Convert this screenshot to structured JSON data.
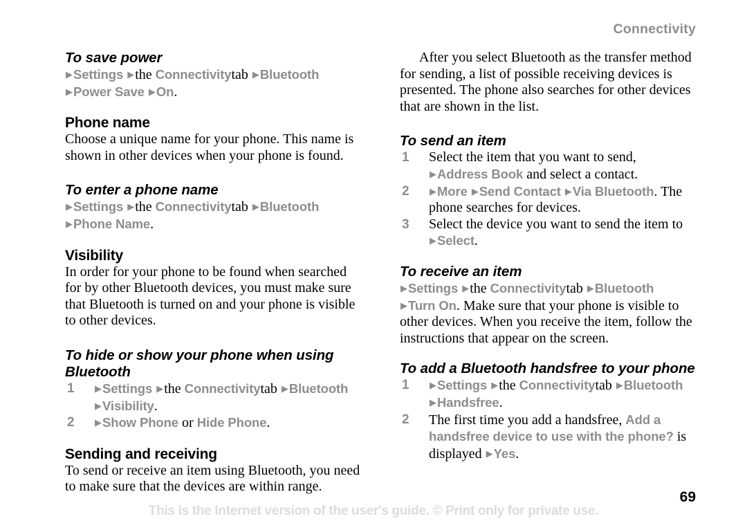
{
  "header": {
    "running_title": "Connectivity"
  },
  "footer": {
    "notice": "This is the Internet version of the user's guide. © Print only for private use.",
    "page_number": "69"
  },
  "glyphs": {
    "arrow": "▶"
  },
  "colors": {
    "ui_term_gray": "#8d8d8d",
    "body_black": "#000000",
    "footer_gray": "#dcdcdc",
    "page_background": "#ffffff"
  },
  "left_column": {
    "save_power": {
      "heading": "To save power",
      "line1": {
        "t1": "Settings",
        "mid": "the",
        "t2": "Connectivity",
        "tab": "tab",
        "t3": "Bluetooth"
      },
      "line2": {
        "t1": "Power Save",
        "t2": "On",
        "period": "."
      }
    },
    "phone_name": {
      "heading": "Phone name",
      "paragraph": "Choose a unique name for your phone. This name is shown in other devices when your phone is found."
    },
    "enter_phone_name": {
      "heading": "To enter a phone name",
      "line1": {
        "t1": "Settings",
        "mid": "the",
        "t2": "Connectivity",
        "tab": "tab",
        "t3": "Bluetooth"
      },
      "line2": {
        "t1": "Phone Name",
        "period": "."
      }
    },
    "visibility": {
      "heading": "Visibility",
      "paragraph": "In order for your phone to be found when searched for by other Bluetooth devices, you must make sure that Bluetooth is turned on and your phone is visible to other devices."
    },
    "hide_or_show": {
      "heading": "To hide or show your phone when using Bluetooth",
      "steps": [
        {
          "num": "1",
          "line1": {
            "t1": "Settings",
            "mid": "the",
            "t2": "Connectivity",
            "tab": "tab",
            "t3": "Bluetooth"
          },
          "line2": {
            "t1": "Visibility",
            "period": "."
          }
        },
        {
          "num": "2",
          "line1": {
            "t1": "Show Phone",
            "mid": "or",
            "t2": "Hide Phone",
            "period": "."
          }
        }
      ]
    },
    "sending_receiving": {
      "heading": "Sending and receiving",
      "paragraph": "To send or receive an item using Bluetooth, you need to make sure that the devices are within range."
    }
  },
  "right_column": {
    "intro_paragraph": "After you select Bluetooth as the transfer method for sending, a list of possible receiving devices is presented. The phone also searches for other devices that are shown in the list.",
    "send_item": {
      "heading": "To send an item",
      "steps": [
        {
          "num": "1",
          "text": "Select the item that you want to send,",
          "sub": {
            "t1": "Address Book",
            "tail": "and select a contact."
          }
        },
        {
          "num": "2",
          "path": {
            "t1": "More",
            "t2": "Send Contact",
            "t3": "Via Bluetooth",
            "tail": ". The"
          },
          "cont": "phone searches for devices."
        },
        {
          "num": "3",
          "text": "Select the device you want to send the item to",
          "sub": {
            "t1": "Select",
            "period": "."
          }
        }
      ]
    },
    "receive_item": {
      "heading": "To receive an item",
      "line1": {
        "t1": "Settings",
        "mid": "the",
        "t2": "Connectivity",
        "tab": "tab",
        "t3": "Bluetooth"
      },
      "line2": {
        "t1": "Turn On",
        "tail": ". Make sure that your phone is visible to"
      },
      "rest": "other devices. When you receive the item, follow the instructions that appear on the screen."
    },
    "add_handsfree": {
      "heading": "To add a Bluetooth handsfree to your phone",
      "steps": [
        {
          "num": "1",
          "line1": {
            "t1": "Settings",
            "mid": "the",
            "t2": "Connectivity",
            "tab": "tab",
            "t3": "Bluetooth"
          },
          "line2": {
            "t1": "Handsfree",
            "period": "."
          }
        },
        {
          "num": "2",
          "lead": "The first time you add a handsfree, ",
          "ui1": "Add a",
          "ui2": "handsfree device to use with the phone?",
          "mid": " is",
          "lead2": "displayed",
          "ui3": "Yes",
          "period": "."
        }
      ]
    }
  }
}
